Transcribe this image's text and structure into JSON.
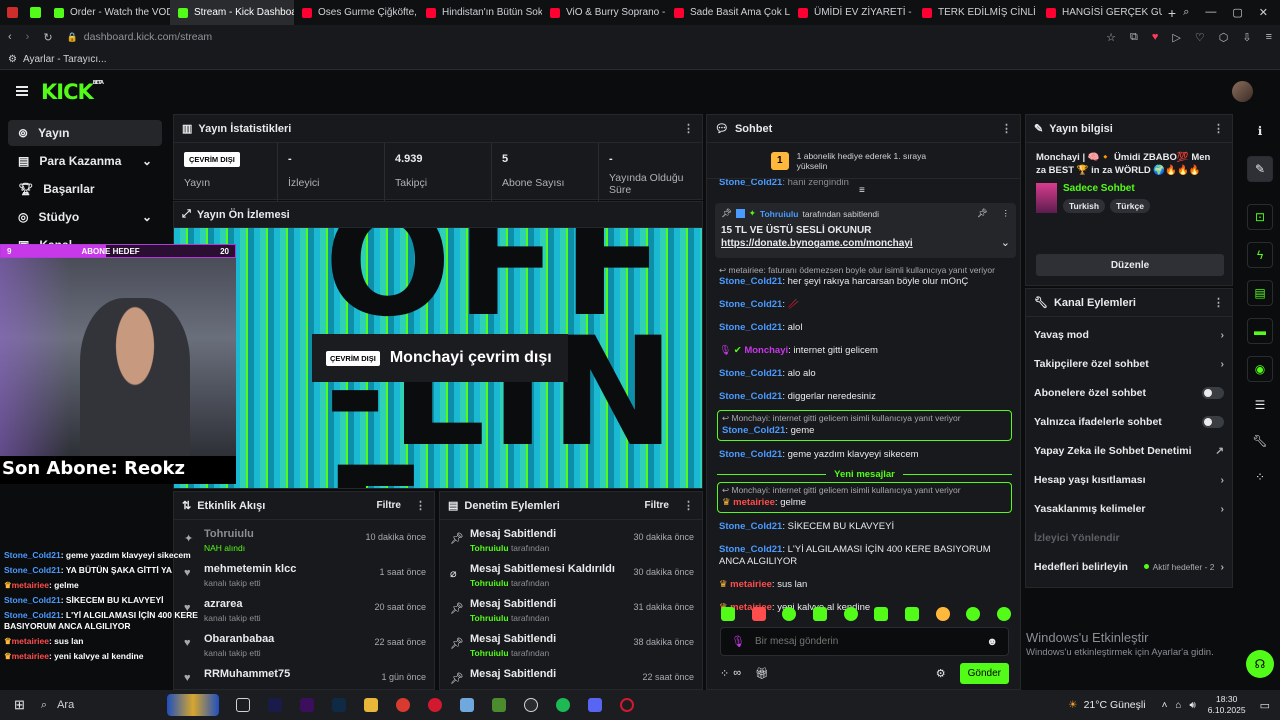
{
  "browser": {
    "tabs": [
      {
        "label": "Order - Watch the VOD o",
        "color": "#53fc18"
      },
      {
        "label": "Stream - Kick Dashboard",
        "color": "#53fc18",
        "active": true
      },
      {
        "label": "Oses Gurme Çiğköfte, K",
        "color": "#ff0033"
      },
      {
        "label": "Hindistan'ın Bütün Sokak",
        "color": "#ff0033"
      },
      {
        "label": "ViO & Burry Soprano - Y",
        "color": "#ff0033"
      },
      {
        "label": "Sade Basit Ama Çok Le",
        "color": "#ff0033"
      },
      {
        "label": "ÜMİDİ EV ZİYARETİ - Yo",
        "color": "#ff0033"
      },
      {
        "label": "TERK EDİLMİŞ CİNLİ KÖ",
        "color": "#ff0033"
      },
      {
        "label": "HANGİSİ GERÇEK GURB",
        "color": "#ff0033"
      }
    ],
    "url_host": "dashboard.kick.com",
    "url_path": "/stream",
    "bookmark": "Ayarlar - Tarayıcı..."
  },
  "brand": {
    "logo": "KICK",
    "beta": "BETA",
    "accent": "#53fc18"
  },
  "nav": [
    {
      "label": "Yayın",
      "icon": "broadcast-icon"
    },
    {
      "label": "Para Kazanma",
      "icon": "money-icon"
    },
    {
      "label": "Başarılar",
      "icon": "trophy-icon"
    },
    {
      "label": "Stüdyo",
      "icon": "studio-icon"
    },
    {
      "label": "Kanal",
      "icon": "channel-icon"
    }
  ],
  "stats": {
    "title": "Yayın İstatistikleri",
    "status_badge": "ÇEVRİM DIŞI",
    "status_label": "Yayın",
    "items": [
      {
        "value": "-",
        "label": "İzleyici"
      },
      {
        "value": "4.939",
        "label": "Takipçi"
      },
      {
        "value": "5",
        "label": "Abone Sayısı"
      },
      {
        "value": "-",
        "label": "Yayında Olduğu Süre"
      }
    ]
  },
  "preview": {
    "title": "Yayın Ön İzlemesi",
    "badge": "ÇEVRİM DIŞI",
    "text": "Monchayi çevrim dışı",
    "offline_art": "OFF-LINE"
  },
  "overlay": {
    "goal_left": "9",
    "goal_label": "ABONE HEDEF",
    "goal_right": "20",
    "goal_progress": 0.45,
    "last_sub": "Son Abone: Reokz",
    "chat": [
      {
        "user": "Stone_Cold21",
        "color": "blue",
        "text": "geme yazdım klavyeyi sikecem"
      },
      {
        "user": "Stone_Cold21",
        "color": "blue",
        "text": "YA BÜTÜN ŞAKA GİTTİ YA"
      },
      {
        "user": "metairiee",
        "color": "red",
        "text": "gelme"
      },
      {
        "user": "Stone_Cold21",
        "color": "blue",
        "text": "SİKECEM BU KLAVYEYİ"
      },
      {
        "user": "Stone_Cold21",
        "color": "blue",
        "text": "L'Yİ ALGILAMASI İÇİN 400 KERE BASIYORUM ANCA ALGILIYOR"
      },
      {
        "user": "metairiee",
        "color": "red",
        "text": "sus lan"
      },
      {
        "user": "metairiee",
        "color": "red",
        "text": "yeni kalvye al kendine"
      }
    ]
  },
  "activity": {
    "title": "Etkinlik Akışı",
    "filter": "Filtre",
    "items": [
      {
        "name": "Tohruiulu",
        "sub": "NAH alındı",
        "time": "10 dakika önce"
      },
      {
        "name": "mehmetemin klcc",
        "sub": "kanalı takip etti",
        "time": "1 saat önce"
      },
      {
        "name": "azrarea",
        "sub": "kanalı takip etti",
        "time": "20 saat önce"
      },
      {
        "name": "Obaranbabaa",
        "sub": "kanalı takip etti",
        "time": "22 saat önce"
      },
      {
        "name": "RRMuhammet75",
        "sub": "",
        "time": "1 gün önce"
      }
    ]
  },
  "moderation": {
    "title": "Denetim Eylemleri",
    "filter": "Filtre",
    "items": [
      {
        "name": "Mesaj Sabitlendi",
        "actor": "Tohruiulu",
        "suffix": "tarafından",
        "time": "30 dakika önce"
      },
      {
        "name": "Mesaj Sabitlemesi Kaldırıldı",
        "actor": "Tohruiulu",
        "suffix": "tarafından",
        "time": "30 dakika önce"
      },
      {
        "name": "Mesaj Sabitlendi",
        "actor": "Tohruiulu",
        "suffix": "tarafından",
        "time": "31 dakika önce"
      },
      {
        "name": "Mesaj Sabitlendi",
        "actor": "Tohruiulu",
        "suffix": "tarafından",
        "time": "38 dakika önce"
      },
      {
        "name": "Mesaj Sabitlendi",
        "actor": "",
        "suffix": "",
        "time": "22 saat önce"
      }
    ]
  },
  "chat": {
    "title": "Sohbet",
    "gift_rank": "1",
    "gift_text": "1 abonelik hediye ederek 1. sıraya yükselin",
    "partial_user": "Stone_Cold21",
    "partial_text": "hani zengindin",
    "pinned": {
      "by_user": "Tohruiulu",
      "by_suffix": "tarafından sabitlendi",
      "line1": "15 TL VE ÜSTÜ SESLİ OKUNUR",
      "link": "https://donate.bynogame.com/monchayi"
    },
    "messages": [
      {
        "reply": "metairiee: faturanı ödemezsen boyle olur isimli kullanıcıya yanıt veriyor",
        "user": "Stone_Cold21",
        "ucolor": "blue",
        "text": "her şeyi rakıya harcarsan böyle olur mOnÇ"
      },
      {
        "user": "Stone_Cold21",
        "ucolor": "blue",
        "text": "🥢"
      },
      {
        "user": "Stone_Cold21",
        "ucolor": "blue",
        "text": "alol"
      },
      {
        "user": "Monchayi",
        "ucolor": "green",
        "text": "internet gitti gelicem"
      },
      {
        "user": "Stone_Cold21",
        "ucolor": "blue",
        "text": "alo alo"
      },
      {
        "user": "Stone_Cold21",
        "ucolor": "blue",
        "text": "diggerlar neredesiniz"
      },
      {
        "reply": "Monchayi: internet gitti gelicem isimli kullanıcıya yanıt veriyor",
        "user": "Stone_Cold21",
        "ucolor": "blue",
        "text": "geme",
        "highlight": true
      },
      {
        "user": "Stone_Cold21",
        "ucolor": "blue",
        "text": "geme yazdım klavyeyi sikecem"
      }
    ],
    "new_label": "Yeni mesajlar",
    "messages2": [
      {
        "reply": "Monchayi: internet gitti gelicem isimli kullanıcıya yanıt veriyor",
        "user": "metairiee",
        "ucolor": "red",
        "text": "gelme",
        "highlight": true
      },
      {
        "user": "Stone_Cold21",
        "ucolor": "blue",
        "text": "SİKECEM BU KLAVYEYİ"
      },
      {
        "user": "Stone_Cold21",
        "ucolor": "blue",
        "text": "L'Yİ ALGILAMASI İÇİN 400 KERE BASIYORUM ANCA ALGILIYOR"
      },
      {
        "user": "metairiee",
        "ucolor": "red",
        "text": "sus lan"
      },
      {
        "user": "metairiee",
        "ucolor": "red",
        "text": "yeni kalvye al kendine"
      }
    ],
    "input_placeholder": "Bir mesaj gönderin",
    "send": "Gönder"
  },
  "info": {
    "title": "Yayın bilgisi",
    "stream_title": "Monchayi | 🧠🔸 Ümidi ZBABO💯 Men za BEST 🏆 in za WÖRLD 🌍🔥🔥🔥",
    "category": "Sadece Sohbet",
    "tags": [
      "Turkish",
      "Türkçe"
    ],
    "edit": "Düzenle"
  },
  "actions": {
    "title": "Kanal Eylemleri",
    "items": [
      {
        "label": "Yavaş mod",
        "kind": "chevron"
      },
      {
        "label": "Takipçilere özel sohbet",
        "kind": "chevron"
      },
      {
        "label": "Abonelere özel sohbet",
        "kind": "toggle"
      },
      {
        "label": "Yalnızca ifadelerle sohbet",
        "kind": "toggle"
      },
      {
        "label": "Yapay Zeka ile Sohbet Denetimi",
        "kind": "external"
      },
      {
        "label": "Hesap yaşı kısıtlaması",
        "kind": "chevron"
      },
      {
        "label": "Yasaklanmış kelimeler",
        "kind": "chevron"
      },
      {
        "label": "İzleyici Yönlendir",
        "kind": "disabled"
      },
      {
        "label": "Hedefleri belirleyin",
        "kind": "goal",
        "extra": "Aktif hedefler - 2"
      }
    ]
  },
  "windows": {
    "activate_title": "Windows'u Etkinleştir",
    "activate_sub": "Windows'u etkinleştirmek için Ayarlar'a gidin."
  },
  "taskbar": {
    "search": "Ara",
    "weather": "21°C  Güneşli",
    "time": "18:30",
    "date": "6.10.2025"
  }
}
